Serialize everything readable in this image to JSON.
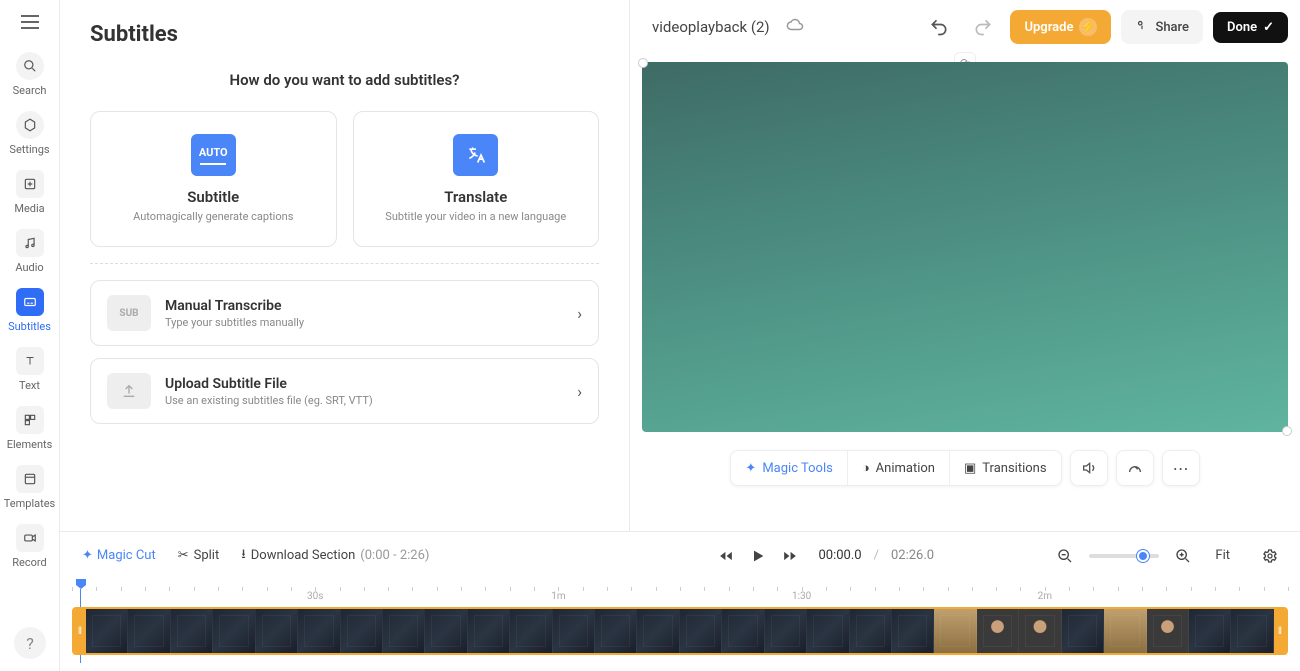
{
  "sidenav": {
    "items": [
      {
        "label": "Search"
      },
      {
        "label": "Settings"
      },
      {
        "label": "Media"
      },
      {
        "label": "Audio"
      },
      {
        "label": "Subtitles"
      },
      {
        "label": "Text"
      },
      {
        "label": "Elements"
      },
      {
        "label": "Templates"
      },
      {
        "label": "Record"
      }
    ]
  },
  "panel": {
    "title": "Subtitles",
    "prompt": "How do you want to add subtitles?",
    "cards": [
      {
        "badge": "AUTO",
        "title": "Subtitle",
        "desc": "Automagically generate captions"
      },
      {
        "title": "Translate",
        "desc": "Subtitle your video in a new language"
      }
    ],
    "rows": [
      {
        "badge": "SUB",
        "title": "Manual Transcribe",
        "desc": "Type your subtitles manually"
      },
      {
        "title": "Upload Subtitle File",
        "desc": "Use an existing subtitles file (eg. SRT, VTT)"
      }
    ]
  },
  "header": {
    "project": "videoplayback (2)",
    "upgrade": "Upgrade",
    "share": "Share",
    "done": "Done"
  },
  "toolbelt": {
    "magic": "Magic Tools",
    "animation": "Animation",
    "transitions": "Transitions"
  },
  "editbar": {
    "magic_cut": "Magic Cut",
    "split": "Split",
    "download": "Download Section",
    "range": "(0:00 - 2:26)",
    "current": "00:00.0",
    "duration": "02:26.0",
    "fit": "Fit"
  },
  "ruler": {
    "marks": [
      {
        "label": "30s",
        "pct": 20
      },
      {
        "label": "1m",
        "pct": 40
      },
      {
        "label": "1:30",
        "pct": 60
      },
      {
        "label": "2m",
        "pct": 80
      }
    ]
  }
}
